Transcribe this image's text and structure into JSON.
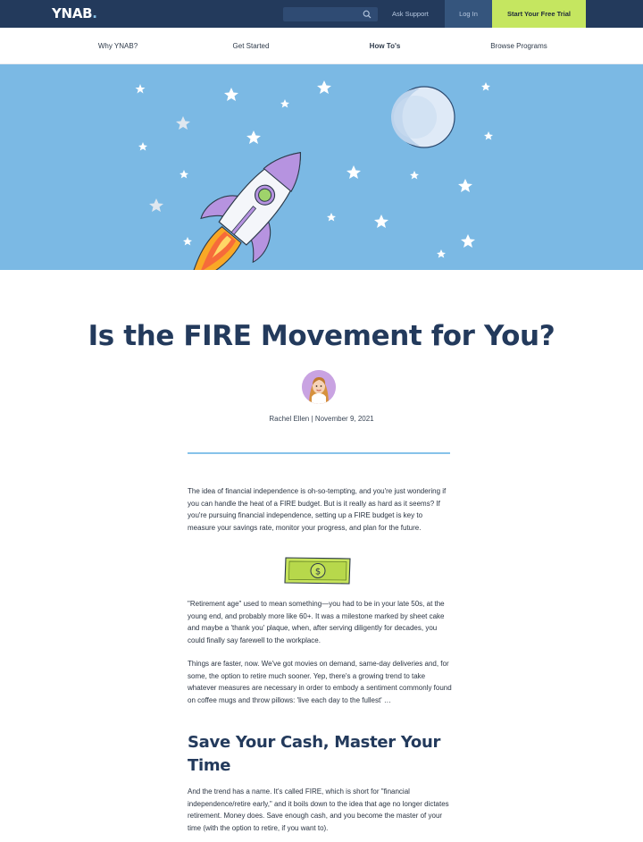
{
  "header": {
    "logo": "YNAB",
    "logo_dot": ".",
    "search_placeholder": "",
    "ask_support": "Ask Support",
    "login": "Log In",
    "trial": "Start Your Free Trial"
  },
  "nav": {
    "items": [
      "Why YNAB?",
      "Get Started",
      "How To's",
      "Browse Programs"
    ],
    "active": "How To's"
  },
  "hero": {
    "icons": [
      "rocket-icon",
      "moon-icon",
      "star-icon"
    ],
    "background": "#7bb9e4"
  },
  "article": {
    "title": "Is the FIRE Movement for You?",
    "author": "Rachel Ellen",
    "separator": "|",
    "date": "November 9, 2021",
    "paragraphs": [
      "The idea of financial independence is oh-so-tempting, and you're just wondering if you can handle the heat of a FIRE budget. But is it really as hard as it seems? If you're pursuing financial independence, setting up a FIRE budget is key to measure your savings rate, monitor your progress, and plan for the future.",
      "\"Retirement age\" used to mean something—you had to be in your late 50s, at the young end, and probably more like 60+. It was a milestone marked by sheet cake and maybe a 'thank you' plaque, when, after serving diligently for decades, you could finally say farewell to the workplace.",
      "Things are faster, now. We've got movies on demand, same-day deliveries and, for some, the option to retire much sooner. Yep, there's a growing trend to take whatever measures are necessary in order to embody a sentiment commonly found on coffee mugs and throw pillows: 'live each day to the fullest' …",
      "And the trend has a name. It's called FIRE, which is short for \"financial independence/retire early,\" and it boils down to the idea that age no longer dictates retirement. Money does. Save enough cash, and you become the master of your time (with the option to retire, if you want to)."
    ],
    "heading": "Save Your Cash, Master Your Time",
    "bill_icon": "dollar-bill-icon"
  },
  "colors": {
    "topbar": "#233a5c",
    "accent": "#c5e660",
    "hero": "#7bb9e4",
    "heading": "#233a5c",
    "rule": "#86c3ea"
  }
}
